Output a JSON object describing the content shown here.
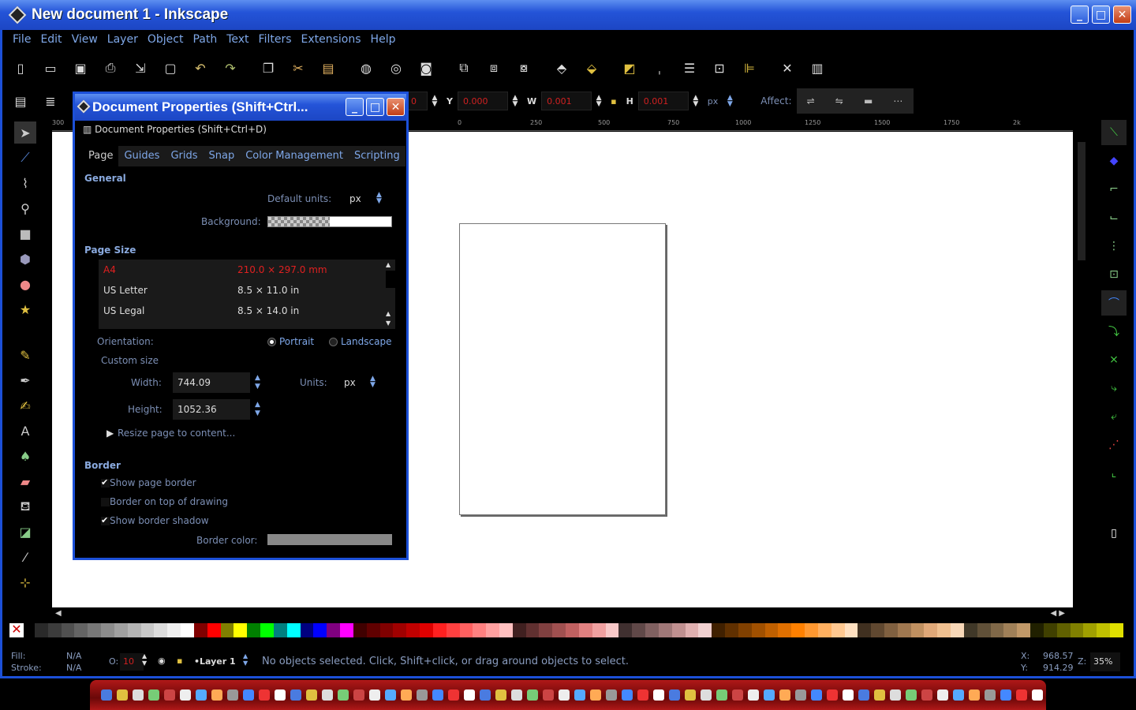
{
  "window": {
    "title": "New document 1 - Inkscape",
    "buttons": [
      "_",
      "□",
      "✕"
    ]
  },
  "menubar": [
    "File",
    "Edit",
    "View",
    "Layer",
    "Object",
    "Path",
    "Text",
    "Filters",
    "Extensions",
    "Help"
  ],
  "toolbar2": {
    "x_value": "0",
    "y_label": "Y",
    "y_value": "0.000",
    "w_label": "W",
    "w_value": "0.001",
    "h_label": "H",
    "h_value": "0.001",
    "units": "px",
    "affect_label": "Affect:"
  },
  "ruler_top": [
    "300",
    "0",
    "250",
    "500",
    "750",
    "1000",
    "1250",
    "1500",
    "1750",
    "2k"
  ],
  "dialog": {
    "title": "Document Properties (Shift+Ctrl...",
    "subtitle": "Document Properties (Shift+Ctrl+D)",
    "tabs": [
      "Page",
      "Guides",
      "Grids",
      "Snap",
      "Color Management",
      "Scripting"
    ],
    "general_heading": "General",
    "default_units_label": "Default units:",
    "default_units_value": "px",
    "background_label": "Background:",
    "page_size_heading": "Page Size",
    "page_sizes": [
      {
        "name": "A4",
        "size": "210.0 × 297.0 mm"
      },
      {
        "name": "US Letter",
        "size": "8.5 × 11.0 in"
      },
      {
        "name": "US Legal",
        "size": "8.5 × 14.0 in"
      }
    ],
    "orientation_label": "Orientation:",
    "portrait_label": "Portrait",
    "landscape_label": "Landscape",
    "custom_size_label": "Custom size",
    "width_label": "Width:",
    "width_value": "744.09",
    "height_label": "Height:",
    "height_value": "1052.36",
    "units_label": "Units:",
    "units_value": "px",
    "resize_label": "Resize page to content...",
    "border_heading": "Border",
    "show_page_border": "Show page border",
    "border_on_top": "Border on top of drawing",
    "show_border_shadow": "Show border shadow",
    "border_color_label": "Border color:"
  },
  "statusbar": {
    "fill_label": "Fill:",
    "fill_value": "N/A",
    "stroke_label": "Stroke:",
    "stroke_value": "N/A",
    "opacity_label": "O:",
    "opacity_value": "10",
    "layer": "•Layer 1",
    "message": "No objects selected. Click, Shift+click, or drag around objects to select.",
    "x_label": "X:",
    "x_value": "968.57",
    "y_label": "Y:",
    "y_value": "914.29",
    "z_label": "Z:",
    "zoom": "35%"
  },
  "palette": [
    "#2a2a2a",
    "#3c3c3c",
    "#505050",
    "#646464",
    "#787878",
    "#8c8c8c",
    "#a0a0a0",
    "#b4b4b4",
    "#c8c8c8",
    "#dcdcdc",
    "#f0f0f0",
    "#ffffff",
    "#800000",
    "#ff0000",
    "#808000",
    "#ffff00",
    "#008000",
    "#00ff00",
    "#008080",
    "#00ffff",
    "#000080",
    "#0000ff",
    "#800080",
    "#ff00ff",
    "#400000",
    "#600000",
    "#800000",
    "#a00000",
    "#c00000",
    "#e00000",
    "#ff2020",
    "#ff4040",
    "#ff6060",
    "#ff8080",
    "#ffa0a0",
    "#ffc0c0",
    "#402020",
    "#603030",
    "#804040",
    "#a05050",
    "#c06060",
    "#e08080",
    "#f0a0a0",
    "#f8c8c8",
    "#403030",
    "#604848",
    "#806060",
    "#a07878",
    "#c09090",
    "#e0b0b0",
    "#f0d0d0",
    "#402000",
    "#603000",
    "#804000",
    "#a05000",
    "#c06000",
    "#e07000",
    "#ff8000",
    "#ff9830",
    "#ffb060",
    "#ffc890",
    "#ffe0c0",
    "#403020",
    "#604830",
    "#806040",
    "#a07850",
    "#c09060",
    "#e0a878",
    "#f0c090",
    "#f8d8b8",
    "#403828",
    "#605038",
    "#806848",
    "#a08058",
    "#c09868",
    "#202000",
    "#404000",
    "#606000",
    "#808000",
    "#a0a000",
    "#c0c000",
    "#e0e000"
  ]
}
